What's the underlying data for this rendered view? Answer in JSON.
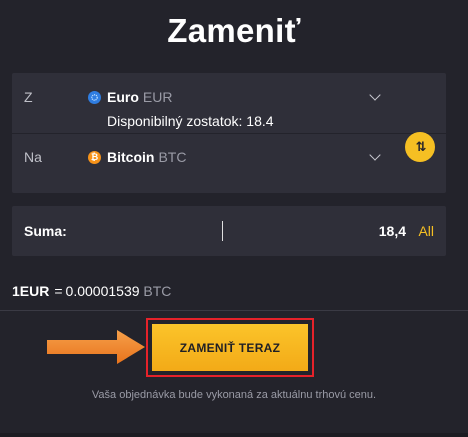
{
  "header": {
    "title": "Zameniť"
  },
  "exchange": {
    "from": {
      "label": "Z",
      "coin_name": "Euro",
      "coin_code": "EUR",
      "icon": "euro-coin-icon",
      "icon_color": "#2f7de1",
      "balance_label": "Disponibilný zostatok:",
      "balance_value": "18.4"
    },
    "to": {
      "label": "Na",
      "coin_name": "Bitcoin",
      "coin_code": "BTC",
      "icon": "bitcoin-icon",
      "icon_color": "#f7931a"
    },
    "swap_icon": "swap-arrows-icon"
  },
  "amount": {
    "label": "Suma:",
    "value": "18,4",
    "all_label": "All"
  },
  "rate": {
    "base": "1EUR",
    "eq": "=",
    "value": "0.00001539",
    "code": "BTC"
  },
  "cta": {
    "label": "ZAMENIŤ TERAZ"
  },
  "note": "Vaša objednávka bude vykonaná za aktuálnu trhovú cenu.",
  "colors": {
    "accent": "#f5bf23",
    "background": "#23232b",
    "panel": "#2f2f39",
    "highlight_frame": "#e5222a",
    "pointer_arrow": "#f08a2a"
  }
}
